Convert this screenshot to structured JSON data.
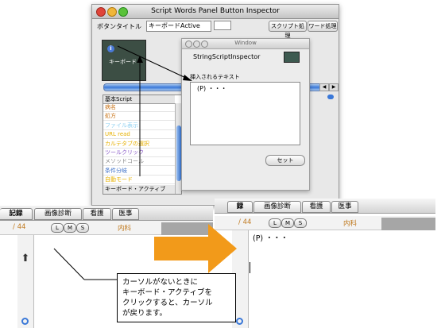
{
  "inspector": {
    "title": "Script Words Panel Button Inspector",
    "button_title_label": "ボタンタイトル",
    "button_title_value": "キーボードActive",
    "script_button": "スクリプト処理",
    "word_button": "ワード処理",
    "list_header": "基本Script",
    "list_items": [
      {
        "label": "病名",
        "color": "#c8741a"
      },
      {
        "label": "処方",
        "color": "#c8741a"
      },
      {
        "label": "ファイル表示",
        "color": "#8fd0f0"
      },
      {
        "label": "URL read",
        "color": "#e6b000"
      },
      {
        "label": "カルテタブの選択",
        "color": "#e6b000"
      },
      {
        "label": "ツールクリック",
        "color": "#8a5ac8"
      },
      {
        "label": "メソッドコール",
        "color": "#8a8a8a"
      },
      {
        "label": "条件分岐",
        "color": "#3a6ec8"
      },
      {
        "label": "自動モード",
        "color": "#e6b000"
      },
      {
        "label": "キーボード・アクティブ",
        "color": "#000000"
      }
    ],
    "preview_icon": "info-icon",
    "preview_label": "キーボード"
  },
  "floating_window": {
    "title": "Window",
    "inspector_label": "StringScriptInspector",
    "inserted_text_label": "挿入されるテキスト",
    "text_value": "(P) ・・・",
    "set_button": "セット"
  },
  "left_panel": {
    "tabs": [
      "記録",
      "画像診断",
      "看護",
      "医事"
    ],
    "page": "/ 44",
    "lms": [
      "L",
      "M",
      "S"
    ],
    "department": "内科"
  },
  "right_panel": {
    "tabs": [
      "録",
      "画像診断",
      "看護",
      "医事"
    ],
    "page": "/ 44",
    "lms": [
      "L",
      "M",
      "S"
    ],
    "department": "内科",
    "text": "(P) ・・・"
  },
  "callout": {
    "lines": [
      "カーソルがないときに",
      "キーボード・アクティブを",
      "クリックすると、カーソル",
      "が戻ります。"
    ]
  },
  "colors": {
    "arrow": "#f29a1a",
    "accent_blue": "#3a78d8"
  }
}
